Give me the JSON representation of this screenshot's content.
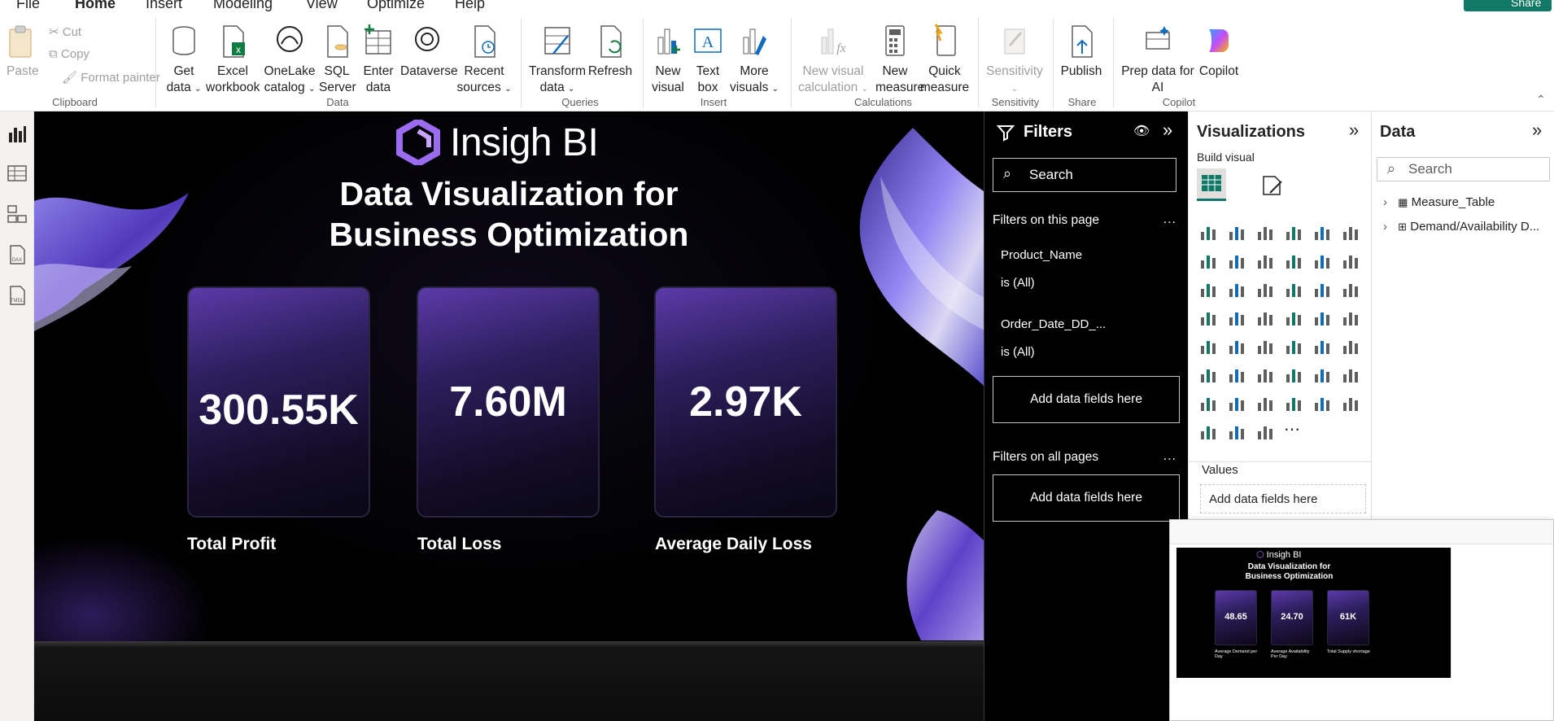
{
  "menu": {
    "file": "File",
    "home": "Home",
    "insert": "Insert",
    "modeling": "Modeling",
    "view": "View",
    "optimize": "Optimize",
    "help": "Help",
    "share": "Share"
  },
  "ribbon": {
    "paste": "Paste",
    "cut": "Cut",
    "copy": "Copy",
    "format_painter": "Format painter",
    "clipboard_group": "Clipboard",
    "get_data": "Get data",
    "excel_workbook": "Excel workbook",
    "onelake_catalog": "OneLake catalog",
    "sql_server": "SQL Server",
    "enter_data": "Enter data",
    "dataverse": "Dataverse",
    "recent_sources": "Recent sources",
    "data_group": "Data",
    "transform_data": "Transform data",
    "refresh": "Refresh",
    "queries_group": "Queries",
    "new_visual": "New visual",
    "text_box": "Text box",
    "more_visuals": "More visuals",
    "insert_group": "Insert",
    "new_visual_calc": "New visual calculation",
    "new_measure": "New measure",
    "quick_measure": "Quick measure",
    "calculations_group": "Calculations",
    "sensitivity": "Sensitivity",
    "sensitivity_group": "Sensitivity",
    "publish": "Publish",
    "share_group": "Share",
    "prep_data_ai": "Prep data for AI",
    "copilot": "Copilot",
    "copilot_group": "Copilot"
  },
  "report": {
    "logo_text": "Insigh BI",
    "title_line1": "Data Visualization for",
    "title_line2": "Business Optimization",
    "cards": [
      {
        "value": "300.55K",
        "label": "Total Profit"
      },
      {
        "value": "7.60M",
        "label": "Total Loss"
      },
      {
        "value": "2.97K",
        "label": "Average Daily Loss"
      }
    ]
  },
  "filters": {
    "title": "Filters",
    "search_placeholder": "Search",
    "on_this_page": "Filters on this page",
    "filter1_name": "Product_Name",
    "filter1_state": "is (All)",
    "filter2_name": "Order_Date_DD_...",
    "filter2_state": "is (All)",
    "add_fields": "Add data fields here",
    "on_all_pages": "Filters on all pages",
    "add_fields_all": "Add data fields here",
    "more": "..."
  },
  "visualizations": {
    "title": "Visualizations",
    "build_visual": "Build visual",
    "values_label": "Values",
    "values_add": "Add data fields here",
    "more": "..."
  },
  "data_pane": {
    "title": "Data",
    "search_placeholder": "Search",
    "items": [
      {
        "label": "Measure_Table"
      },
      {
        "label": "Demand/Availability D..."
      }
    ]
  },
  "thumbnail": {
    "logo_text": "Insigh BI",
    "title_line1": "Data Visualization for",
    "title_line2": "Business Optimization",
    "cards": [
      {
        "value": "48.65",
        "label": "Average Demand per Day"
      },
      {
        "value": "24.70",
        "label": "Average Availability Per Day"
      },
      {
        "value": "61K",
        "label": "Total Supply shortage"
      }
    ]
  },
  "colors": {
    "accent": "#117865",
    "canvas_bg": "#000000",
    "card_purple": "#5b3aa8",
    "logo_purple": "#9b6cf0"
  }
}
